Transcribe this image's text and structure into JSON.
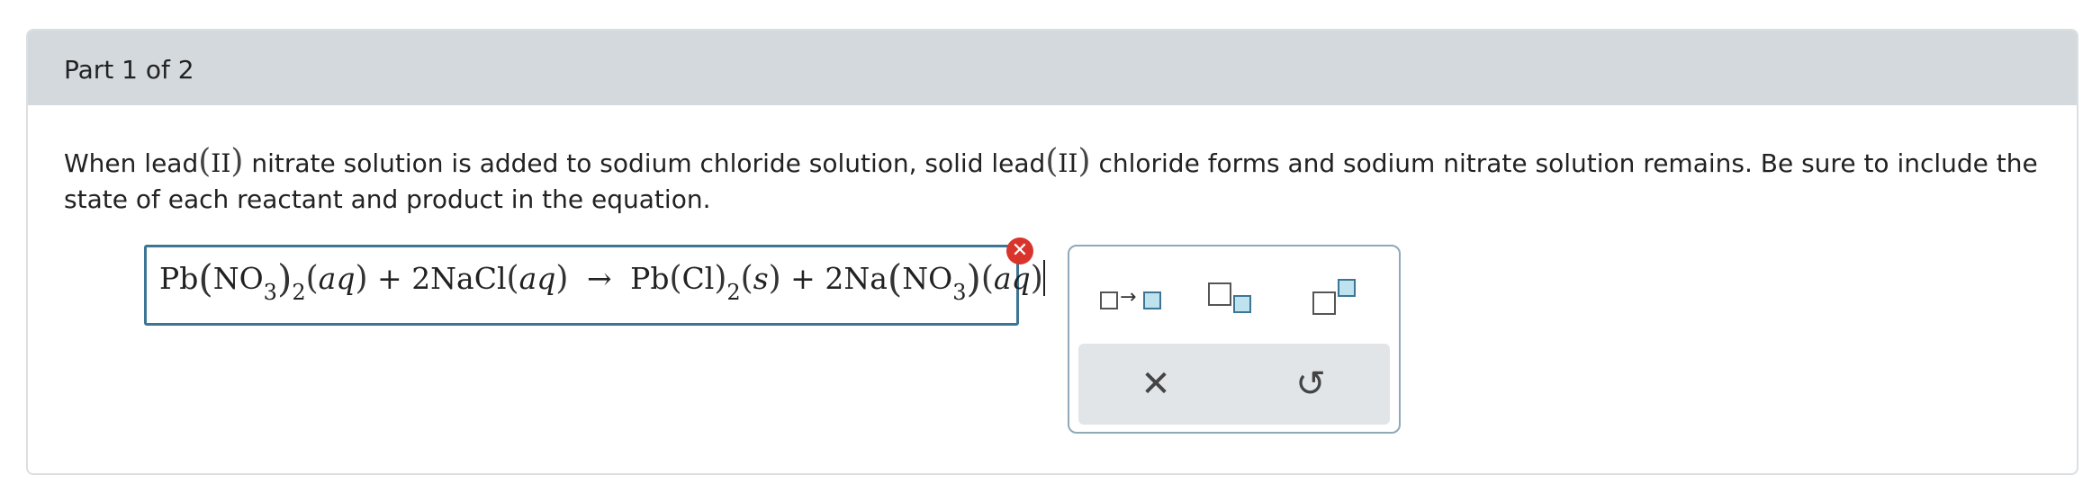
{
  "header": {
    "part_label": "Part 1 of 2"
  },
  "question": {
    "t1": "When lead",
    "ox1": "II",
    "t2": " nitrate solution is added to sodium chloride solution, solid lead",
    "ox2": "II",
    "t3": " chloride forms and sodium nitrate solution remains. Be sure to include the state of each reactant and product in the equation."
  },
  "equation": {
    "r1_el": "Pb",
    "r1_in": "NO",
    "r1_sub_in": "3",
    "r1_sub": "2",
    "r1_state": "aq",
    "plus1": "+",
    "r2": "2NaCl",
    "r2_state": "aq",
    "arrow": "→",
    "p1_el": "Pb",
    "p1_in": "Cl",
    "p1_sub": "2",
    "p1_state": "s",
    "plus2": "+",
    "p2_el": "2Na",
    "p2_in": "NO",
    "p2_sub_in": "3",
    "p2_state": "aq"
  },
  "error": {
    "icon": "✕"
  },
  "toolbar": {
    "tools": [
      "reaction-arrow-icon",
      "subscript-icon",
      "superscript-icon"
    ],
    "clear_label": "✕",
    "undo_label": "↺"
  }
}
